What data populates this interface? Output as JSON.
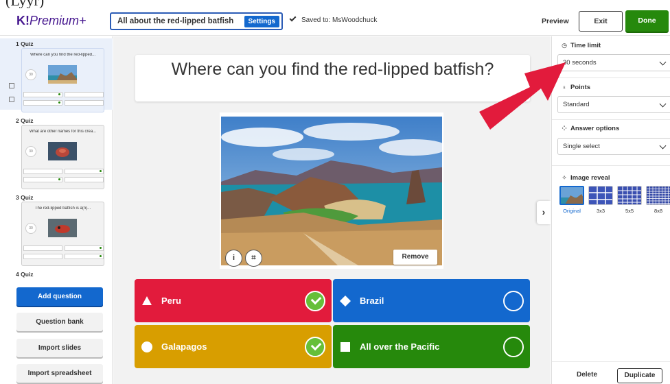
{
  "header": {
    "logo_mark": "K!",
    "logo_text": "Premium+",
    "quiz_title": "All about the red-lipped batfish",
    "settings_label": "Settings",
    "saved_text": "Saved to: MsWoodchuck",
    "preview_label": "Preview",
    "exit_label": "Exit",
    "done_label": "Done"
  },
  "sidebar": {
    "slides": [
      {
        "label": "1 Quiz",
        "question": "Where can you find the red-lipped...",
        "timer": "30"
      },
      {
        "label": "2 Quiz",
        "question": "What are other names for this crea...",
        "timer": "30"
      },
      {
        "label": "3 Quiz",
        "question": "The red-lipped batfish is a(n)...",
        "timer": "30"
      },
      {
        "label": "4 Quiz"
      }
    ],
    "buttons": {
      "add_question": "Add question",
      "question_bank": "Question bank",
      "import_slides": "Import slides",
      "import_spreadsheet": "Import spreadsheet"
    }
  },
  "main": {
    "question": "Where can you find the red-lipped batfish?",
    "remove_label": "Remove",
    "info_glyph": "i",
    "crop_glyph": "⌗",
    "answers": [
      {
        "label": "Peru",
        "shape": "triangle",
        "color": "#e21b3c",
        "correct": true
      },
      {
        "label": "Brazil",
        "shape": "diamond",
        "color": "#1368ce",
        "correct": false
      },
      {
        "label": "Galapagos",
        "shape": "circle",
        "color": "#d89e00",
        "correct": true
      },
      {
        "label": "All over the Pacific",
        "shape": "square",
        "color": "#26890c",
        "correct": false
      }
    ]
  },
  "panel": {
    "collapse_glyph": "›",
    "time_limit_label": "Time limit",
    "time_limit_value": "30 seconds",
    "points_label": "Points",
    "points_value": "Standard",
    "answer_options_label": "Answer options",
    "answer_options_value": "Single select",
    "image_reveal_label": "Image reveal",
    "reveal_options": [
      "Original",
      "3x3",
      "5x5",
      "8x8"
    ],
    "reveal_selected": "Original",
    "delete_label": "Delete",
    "duplicate_label": "Duplicate"
  },
  "colors": {
    "brand_purple": "#46178f",
    "primary_blue": "#1368ce",
    "done_green": "#26890c",
    "arrow_red": "#e21b3c"
  }
}
